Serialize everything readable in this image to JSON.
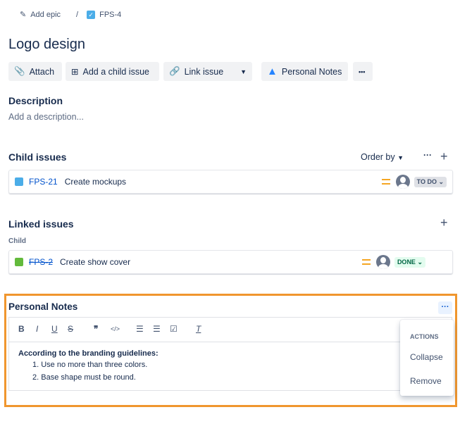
{
  "breadcrumb": {
    "epic": "Add epic",
    "separator": "/",
    "issue_key": "FPS-4"
  },
  "title": "Logo design",
  "toolbar": {
    "attach": "Attach",
    "add_child": "Add a child issue",
    "link_issue": "Link issue",
    "personal_notes": "Personal Notes",
    "more": "•••"
  },
  "description": {
    "heading": "Description",
    "placeholder": "Add a description..."
  },
  "child_issues": {
    "heading": "Child issues",
    "order_by": "Order by",
    "items": [
      {
        "key": "FPS-21",
        "summary": "Create mockups",
        "status": "TO DO"
      }
    ]
  },
  "linked_issues": {
    "heading": "Linked issues",
    "group": "Child",
    "items": [
      {
        "key": "FPS-2",
        "summary": "Create show cover",
        "status": "DONE"
      }
    ]
  },
  "notes": {
    "heading": "Personal Notes",
    "dots": "···",
    "heading_line": "According to the branding guidelines:",
    "list": [
      "Use no more than three colors.",
      "Base shape must be round."
    ]
  },
  "menu": {
    "heading": "ACTIONS",
    "items": [
      "Collapse",
      "Remove"
    ]
  },
  "colors": {
    "accent": "#0052cc",
    "highlight": "#f0962e"
  }
}
